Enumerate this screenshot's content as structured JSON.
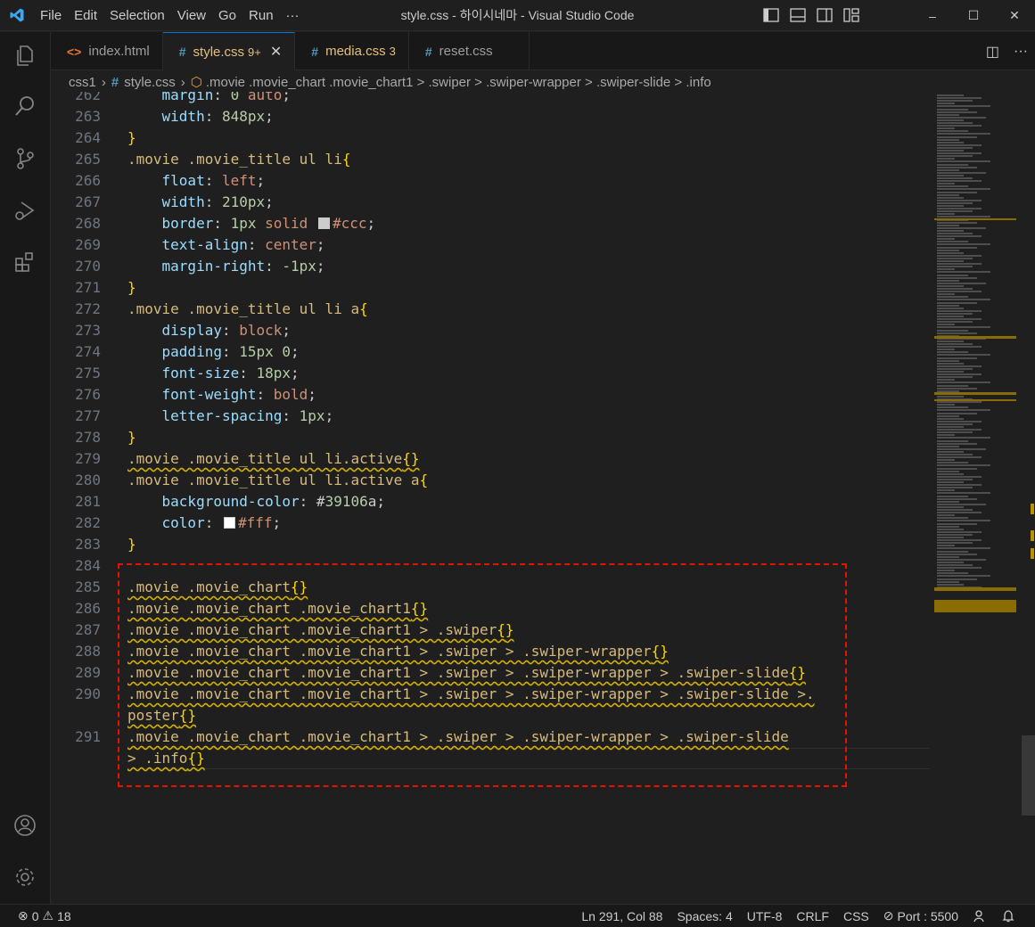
{
  "titlebar": {
    "menu": [
      "File",
      "Edit",
      "Selection",
      "View",
      "Go",
      "Run",
      "···"
    ],
    "title": "style.css - 하이시네마 - Visual Studio Code",
    "controls": {
      "minimize": "–",
      "maximize": "☐",
      "close": "✕"
    }
  },
  "tabs": [
    {
      "icon": "<>",
      "label": "index.html",
      "badge": "",
      "close": ""
    },
    {
      "icon": "#",
      "label": "style.css",
      "badge": "9+",
      "close": "✕"
    },
    {
      "icon": "#",
      "label": "media.css",
      "badge": "3",
      "close": ""
    },
    {
      "icon": "#",
      "label": "reset.css",
      "badge": "",
      "close": ""
    }
  ],
  "tab_actions": {
    "split": "◫",
    "more": "···"
  },
  "breadcrumb": {
    "folder": "css1",
    "file_icon": "#",
    "file": "style.css",
    "symbol": ".movie .movie_chart .movie_chart1 > .swiper > .swiper-wrapper > .swiper-slide > .info"
  },
  "editor": {
    "lines": [
      {
        "no": "262",
        "code": "    margin: 0 auto;"
      },
      {
        "no": "263",
        "code": "    width: 848px;"
      },
      {
        "no": "264",
        "code": "}"
      },
      {
        "no": "265",
        "code": ".movie .movie_title ul li{"
      },
      {
        "no": "266",
        "code": "    float: left;"
      },
      {
        "no": "267",
        "code": "    width: 210px;"
      },
      {
        "no": "268",
        "code": "    border: 1px solid #ccc;"
      },
      {
        "no": "269",
        "code": "    text-align: center;"
      },
      {
        "no": "270",
        "code": "    margin-right: -1px;"
      },
      {
        "no": "271",
        "code": "}"
      },
      {
        "no": "272",
        "code": ".movie .movie_title ul li a{"
      },
      {
        "no": "273",
        "code": "    display: block;"
      },
      {
        "no": "274",
        "code": "    padding: 15px 0;"
      },
      {
        "no": "275",
        "code": "    font-size: 18px;"
      },
      {
        "no": "276",
        "code": "    font-weight: bold;"
      },
      {
        "no": "277",
        "code": "    letter-spacing: 1px;"
      },
      {
        "no": "278",
        "code": "}"
      },
      {
        "no": "279",
        "code": ".movie .movie_title ul li.active{}"
      },
      {
        "no": "280",
        "code": ".movie .movie_title ul li.active a{"
      },
      {
        "no": "281",
        "code": "    background-color: #39106a;"
      },
      {
        "no": "282",
        "code": "    color: #fff;"
      },
      {
        "no": "283",
        "code": "}"
      },
      {
        "no": "284",
        "code": ""
      },
      {
        "no": "285",
        "code": ".movie .movie_chart{}"
      },
      {
        "no": "286",
        "code": ".movie .movie_chart .movie_chart1{}"
      },
      {
        "no": "287",
        "code": ".movie .movie_chart .movie_chart1 > .swiper{}"
      },
      {
        "no": "288",
        "code": ".movie .movie_chart .movie_chart1 > .swiper > .swiper-wrapper{}"
      },
      {
        "no": "289",
        "code": ".movie .movie_chart .movie_chart1 > .swiper > .swiper-wrapper > .swiper-slide{}"
      },
      {
        "no": "290",
        "code": ".movie .movie_chart .movie_chart1 > .swiper > .swiper-wrapper > .swiper-slide >."
      },
      {
        "no": "",
        "code": "poster{}"
      },
      {
        "no": "291",
        "code": ".movie .movie_chart .movie_chart1 > .swiper > .swiper-wrapper > .swiper-slide"
      },
      {
        "no": "",
        "code": "> .info{}"
      }
    ],
    "swatch_colors": {
      "ccc": "#cccccc",
      "purple": "#39106a",
      "white": "#ffffff"
    }
  },
  "statusbar": {
    "errors": "0",
    "warnings": "18",
    "position": "Ln 291, Col 88",
    "spaces": "Spaces: 4",
    "encoding": "UTF-8",
    "eol": "CRLF",
    "language": "CSS",
    "port": "Port : 5500"
  },
  "colors": {
    "accent": "#0078d4",
    "highlight_box": "#e51400",
    "warning": "#d4b000"
  }
}
